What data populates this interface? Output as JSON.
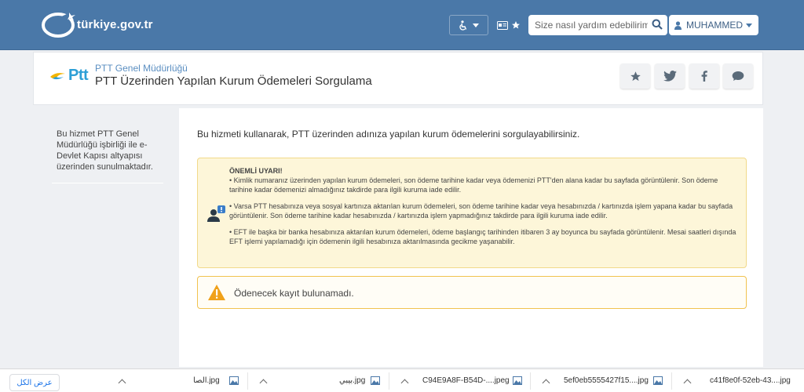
{
  "header": {
    "logo_text": "türkiye.gov.tr",
    "search_placeholder": "Size nasıl yardım edebilirim?",
    "user_name": "MUHAMMED"
  },
  "service": {
    "org": "PTT Genel Müdürlüğü",
    "logo_text": "Ptt",
    "title": "PTT Üzerinden Yapılan Kurum Ödemeleri Sorgulama"
  },
  "sidebar": {
    "text": "Bu hizmet PTT Genel Müdürlüğü işbirliği ile e-Devlet Kapısı altyapısı üzerinden sunulmaktadır."
  },
  "content": {
    "intro": "Bu hizmeti kullanarak, PTT üzerinden adınıza yapılan kurum ödemelerini sorgulayabilirsiniz.",
    "warning_title": "ÖNEMLİ UYARI!",
    "warning_1": "• Kimlik numaranız üzerinden yapılan kurum ödemeleri, son ödeme tarihine kadar veya ödemenizi PTT'den alana kadar bu sayfada görüntülenir. Son ödeme tarihine kadar ödemenizi almadığınız takdirde para ilgili kuruma iade edilir.",
    "warning_2": "• Varsa PTT hesabınıza veya sosyal kartınıza aktarılan kurum ödemeleri, son ödeme tarihine kadar veya hesabınızda / kartınızda işlem yapana kadar bu sayfada görüntülenir. Son ödeme tarihine kadar hesabınızda / kartınızda işlem yapmadığınız takdirde para ilgili kuruma iade edilir.",
    "warning_3": "• EFT ile başka bir banka hesabınıza aktarılan kurum ödemeleri, ödeme başlangıç tarihinden itibaren 3 ay boyunca bu sayfada görüntülenir. Mesai saatleri dışında EFT işlemi yapılamadığı için ödemenin ilgili hesabınıza aktarılmasında gecikme yaşanabilir.",
    "notice": "Ödenecek kayıt bulunamadı."
  },
  "downloads": {
    "show_all": "عرض الكل",
    "items": [
      {
        "name": "الصا.jpg"
      },
      {
        "name": "بيبي.jpg"
      },
      {
        "name": "C94E9A8F-B54D-....jpeg"
      },
      {
        "name": "5ef0eb5555427f15....jpg"
      },
      {
        "name": "c41f8e0f-52eb-43....jpg"
      }
    ]
  },
  "colors": {
    "header_bg": "#4a78a8",
    "warning_bg": "#fdf6d9",
    "notice_border": "#f1c24f",
    "ptt_blue": "#2d9fd6"
  }
}
